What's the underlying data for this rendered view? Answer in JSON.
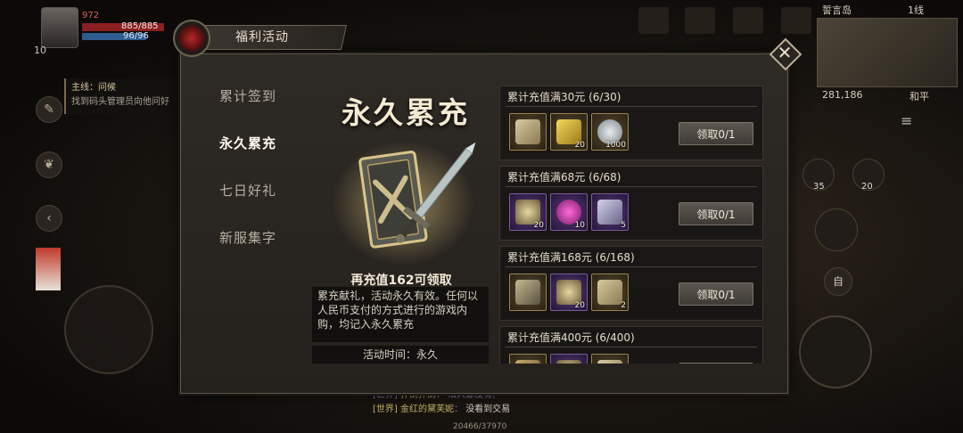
{
  "hud": {
    "player_level": "10",
    "player_name": "972",
    "hp": "885/885",
    "mp": "96/96",
    "quest_title": "主线：问候",
    "quest_desc": "找到码头管理员向他问好",
    "map_name": "誓言岛",
    "channel": "1线",
    "coords": "281,186",
    "pk_mode": "和平",
    "auto_label": "自",
    "skill_counts": [
      "35",
      "20"
    ],
    "chat_lines": [
      {
        "channel": "[世界]",
        "sender": "扑倒扑倒",
        "text": "法人都没有, ***"
      },
      {
        "channel": "[世界]",
        "sender": "金红的黛芙妮",
        "text": "没看到交易"
      }
    ],
    "exp": "20466/37970"
  },
  "modal": {
    "title": "福利活动",
    "close_icon": "close-icon",
    "nav": [
      {
        "label": "累计签到",
        "active": false
      },
      {
        "label": "永久累充",
        "active": true
      },
      {
        "label": "七日好礼",
        "active": false
      },
      {
        "label": "新服集字",
        "active": false
      }
    ],
    "feature": {
      "title": "永久累充",
      "need_text": "再充值162可领取",
      "description": "累充献礼，活动永久有效。任何以人民币支付的方式进行的游戏内购，均记入永久累充",
      "time_text": "活动时间：永久"
    },
    "tiers": [
      {
        "header": "累计充值满30元 (6/30)",
        "progress": [
          6,
          30
        ],
        "claim_label": "领取0/1",
        "items": [
          {
            "icon": "ticket-50-icon",
            "frame": "gold",
            "qty": ""
          },
          {
            "icon": "gold-ingot-icon",
            "frame": "gold",
            "qty": "20"
          },
          {
            "icon": "silver-coin-icon",
            "frame": "gold",
            "qty": "1000"
          }
        ]
      },
      {
        "header": "累计充值满68元 (6/68)",
        "progress": [
          6,
          68
        ],
        "claim_label": "领取0/1",
        "items": [
          {
            "icon": "star-crystal-icon",
            "frame": "purple",
            "qty": "20"
          },
          {
            "icon": "magenta-gem-icon",
            "frame": "purple",
            "qty": "10"
          },
          {
            "icon": "rune-stone-icon",
            "frame": "purple",
            "qty": "5"
          }
        ]
      },
      {
        "header": "累计充值满168元 (6/168)",
        "progress": [
          6,
          168
        ],
        "claim_label": "领取0/1",
        "items": [
          {
            "icon": "rune-book-icon",
            "frame": "gold",
            "qty": ""
          },
          {
            "icon": "star-crystal-icon",
            "frame": "purple",
            "qty": "20"
          },
          {
            "icon": "ticket-50-icon",
            "frame": "gold",
            "qty": "2"
          }
        ]
      },
      {
        "header": "累计充值满400元 (6/400)",
        "progress": [
          6,
          400
        ],
        "claim_label": "",
        "items": [
          {
            "icon": "scroll-icon",
            "frame": "gold",
            "qty": ""
          },
          {
            "icon": "star-crystal-icon",
            "frame": "purple",
            "qty": ""
          },
          {
            "icon": "ticket-icon",
            "frame": "gold",
            "qty": ""
          }
        ]
      }
    ]
  },
  "colors": {
    "panel_bg": "#2a2622",
    "gold_text": "#f4ead2",
    "hp": "#8a2020",
    "mp": "#2e5c90"
  }
}
